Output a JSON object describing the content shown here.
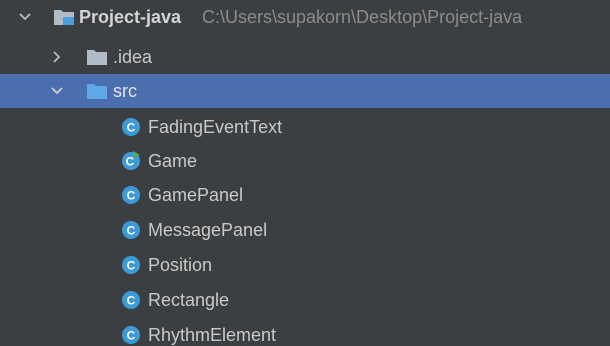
{
  "project": {
    "name": "Project-java",
    "path": "C:\\Users\\supakorn\\Desktop\\Project-java"
  },
  "folders": {
    "idea": ".idea",
    "src": "src"
  },
  "classes": [
    {
      "label": "FadingEventText",
      "icon": "java-class-icon"
    },
    {
      "label": "Game",
      "icon": "java-class-runnable-icon"
    },
    {
      "label": "GamePanel",
      "icon": "java-class-icon"
    },
    {
      "label": "MessagePanel",
      "icon": "java-class-icon"
    },
    {
      "label": "Position",
      "icon": "java-class-icon"
    },
    {
      "label": "Rectangle",
      "icon": "java-class-icon"
    },
    {
      "label": "RhythmElement",
      "icon": "java-class-icon"
    }
  ],
  "colors": {
    "background": "#3c3f41",
    "selection": "#4b6eaf",
    "class_icon": "#3c9ad6",
    "run_badge": "#59a869",
    "folder": "#b1bcc6",
    "module_folder": "#4a9fe0"
  }
}
